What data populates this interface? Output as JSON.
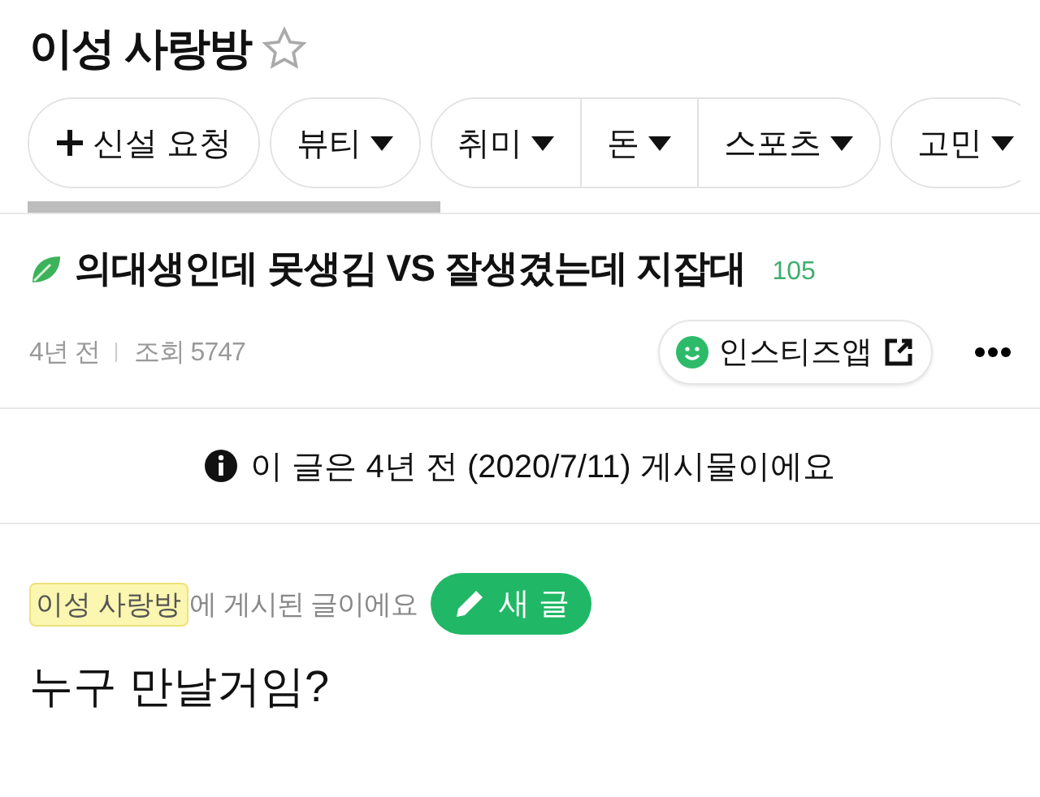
{
  "board": {
    "title": "이성 사랑방"
  },
  "categories": [
    {
      "segments": [
        {
          "label": "신설 요청",
          "kind": "add"
        }
      ]
    },
    {
      "segments": [
        {
          "label": "뷰티",
          "kind": "dropdown"
        }
      ]
    },
    {
      "segments": [
        {
          "label": "취미",
          "kind": "dropdown"
        },
        {
          "label": "돈",
          "kind": "dropdown"
        },
        {
          "label": "스포츠",
          "kind": "dropdown"
        }
      ]
    },
    {
      "segments": [
        {
          "label": "고민",
          "kind": "dropdown"
        }
      ]
    }
  ],
  "post": {
    "title": "의대생인데 못생김 VS 잘생겼는데 지잡대",
    "comment_count": "105",
    "age": "4년 전",
    "views": "조회 5747",
    "app_button": "인스티즈앱",
    "notice": "이 글은 4년 전 (2020/7/11) 게시물이에요",
    "board_tag": "이성 사랑방",
    "board_suffix": "에 게시된 글이에요",
    "new_post_button": "새 글",
    "body": "누구 만날거임?"
  }
}
